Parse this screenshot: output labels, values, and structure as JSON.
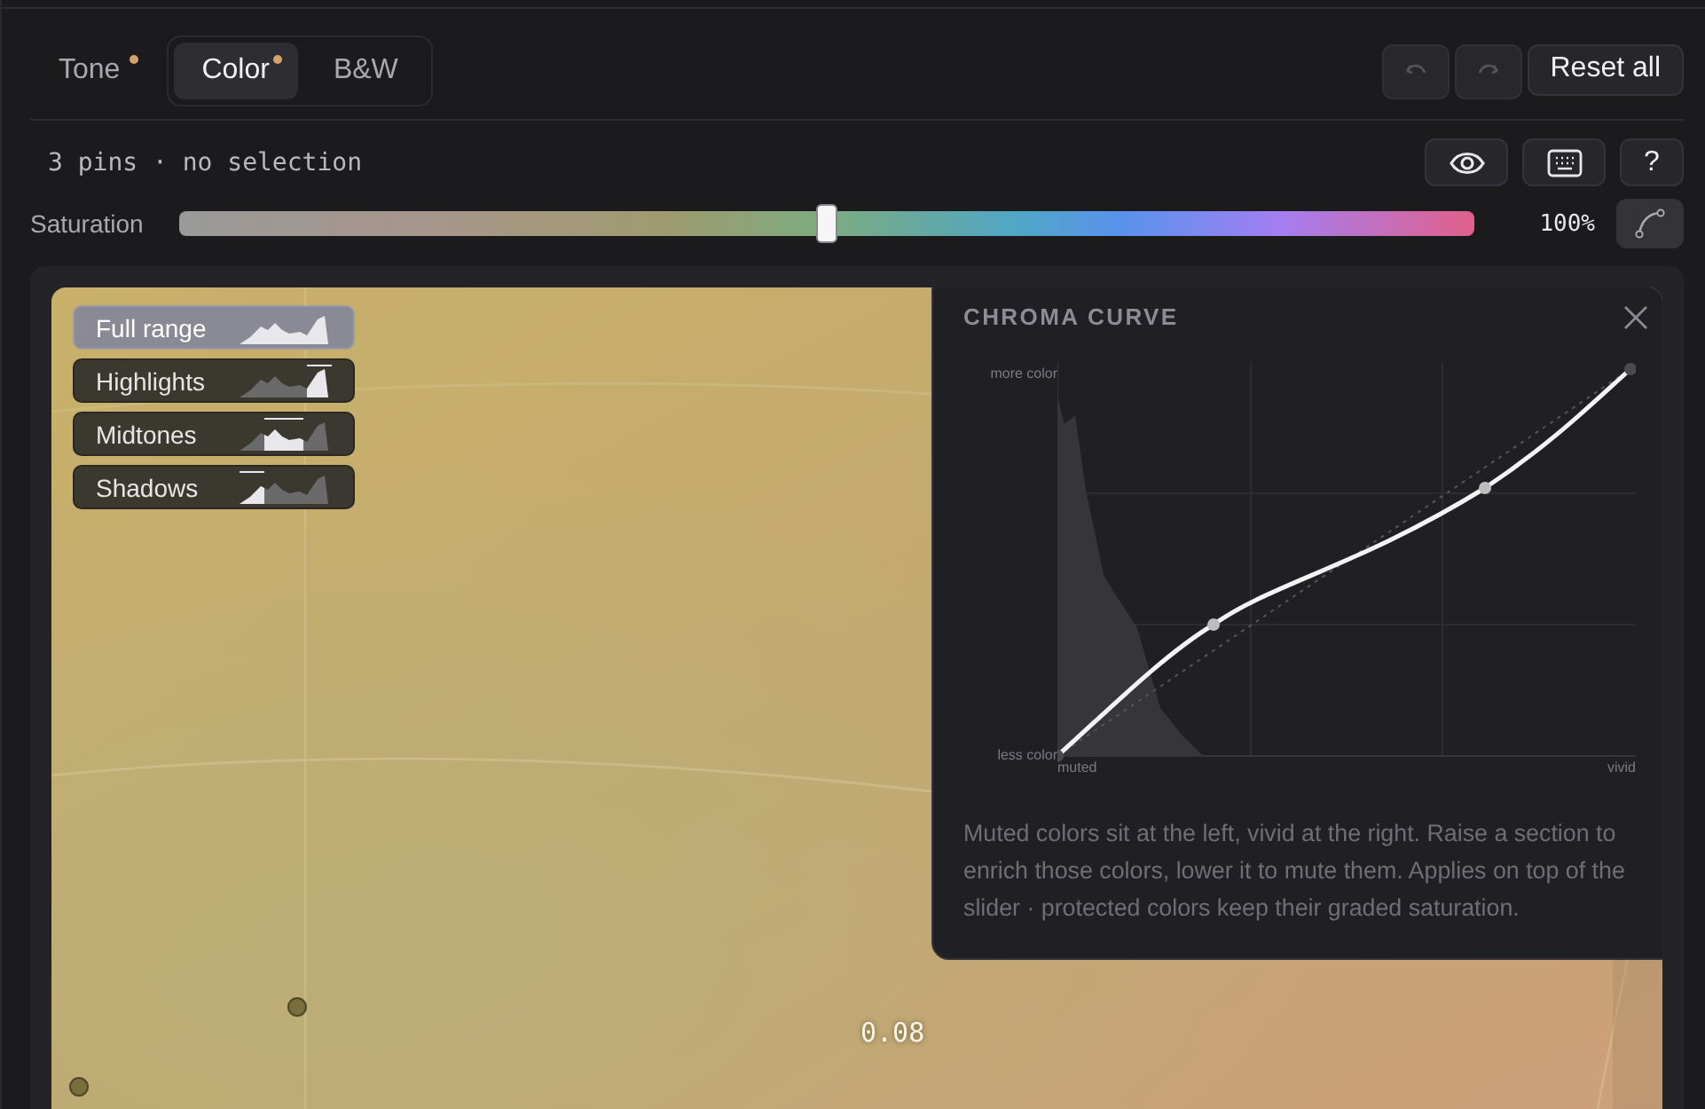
{
  "tabs": [
    {
      "label": "Tone",
      "selected": false,
      "modified": true,
      "kind": "standalone"
    },
    {
      "label": "Color",
      "selected": true,
      "modified": true,
      "kind": "segment"
    },
    {
      "label": "B&W",
      "selected": false,
      "modified": false,
      "kind": "segment"
    }
  ],
  "history": [
    {
      "kind": "undo",
      "disabled": true
    },
    {
      "kind": "redo",
      "disabled": true
    }
  ],
  "reset_button": "Reset all",
  "status": "3 pins · no selection",
  "tool_buttons": [
    {
      "kind": "eye"
    },
    {
      "kind": "keyboard"
    },
    {
      "kind": "help",
      "label": "?"
    }
  ],
  "saturation": {
    "label": "Saturation",
    "level": 0.5,
    "reading": "100%"
  },
  "curve_button": {
    "active": false
  },
  "ranges": [
    {
      "label": "Full range",
      "kind": "full",
      "selected": true
    },
    {
      "label": "Highlights",
      "kind": "highlights",
      "selected": false
    },
    {
      "label": "Midtones",
      "kind": "midtones",
      "selected": false
    },
    {
      "label": "Shadows",
      "kind": "shadows",
      "selected": false
    }
  ],
  "canvas_value": "0.08",
  "popover": {
    "title": "CHROMA CURVE",
    "y_top": "more color",
    "y_bottom": "less color",
    "x_left": "muted",
    "x_right": "vivid",
    "description": "Muted colors sit at the left, vivid at the right. Raise a section to enrich those colors, lower it to mute them. Applies on top of the slider · protected colors keep their graded saturation."
  }
}
